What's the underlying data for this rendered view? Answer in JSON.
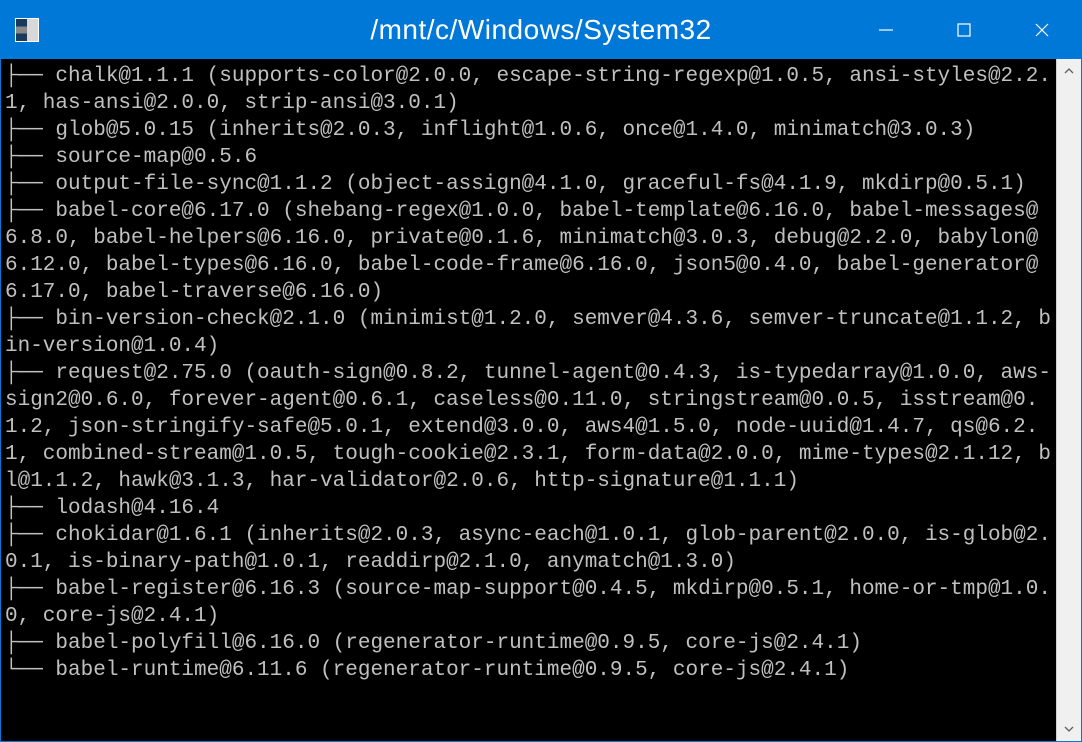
{
  "window": {
    "title": "/mnt/c/Windows/System32"
  },
  "terminal": {
    "lines": [
      "├── chalk@1.1.1 (supports-color@2.0.0, escape-string-regexp@1.0.5, ansi-styles@2.2.1, has-ansi@2.0.0, strip-ansi@3.0.1)",
      "├── glob@5.0.15 (inherits@2.0.3, inflight@1.0.6, once@1.4.0, minimatch@3.0.3)",
      "├── source-map@0.5.6",
      "├── output-file-sync@1.1.2 (object-assign@4.1.0, graceful-fs@4.1.9, mkdirp@0.5.1)",
      "├── babel-core@6.17.0 (shebang-regex@1.0.0, babel-template@6.16.0, babel-messages@6.8.0, babel-helpers@6.16.0, private@0.1.6, minimatch@3.0.3, debug@2.2.0, babylon@6.12.0, babel-types@6.16.0, babel-code-frame@6.16.0, json5@0.4.0, babel-generator@6.17.0, babel-traverse@6.16.0)",
      "├── bin-version-check@2.1.0 (minimist@1.2.0, semver@4.3.6, semver-truncate@1.1.2, bin-version@1.0.4)",
      "├── request@2.75.0 (oauth-sign@0.8.2, tunnel-agent@0.4.3, is-typedarray@1.0.0, aws-sign2@0.6.0, forever-agent@0.6.1, caseless@0.11.0, stringstream@0.0.5, isstream@0.1.2, json-stringify-safe@5.0.1, extend@3.0.0, aws4@1.5.0, node-uuid@1.4.7, qs@6.2.1, combined-stream@1.0.5, tough-cookie@2.3.1, form-data@2.0.0, mime-types@2.1.12, bl@1.1.2, hawk@3.1.3, har-validator@2.0.6, http-signature@1.1.1)",
      "├── lodash@4.16.4",
      "├── chokidar@1.6.1 (inherits@2.0.3, async-each@1.0.1, glob-parent@2.0.0, is-glob@2.0.1, is-binary-path@1.0.1, readdirp@2.1.0, anymatch@1.3.0)",
      "├── babel-register@6.16.3 (source-map-support@0.4.5, mkdirp@0.5.1, home-or-tmp@1.0.0, core-js@2.4.1)",
      "├── babel-polyfill@6.16.0 (regenerator-runtime@0.9.5, core-js@2.4.1)",
      "└── babel-runtime@6.11.6 (regenerator-runtime@0.9.5, core-js@2.4.1)"
    ]
  }
}
